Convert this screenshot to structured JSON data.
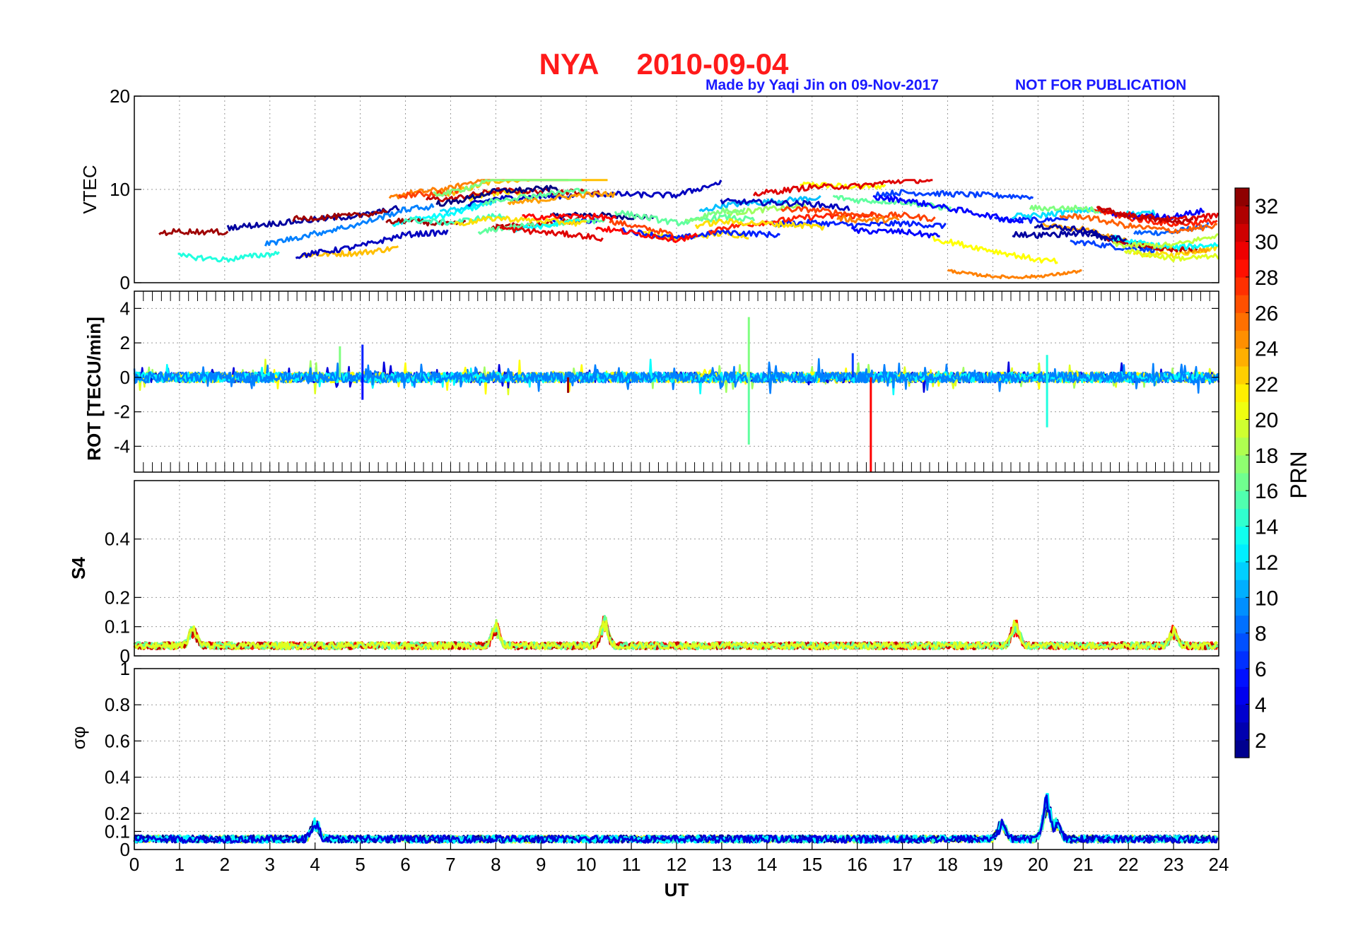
{
  "title": {
    "station": "NYA",
    "date": "2010-09-04",
    "color": "#ff1a1a"
  },
  "credit": {
    "made_by": "Made by Yaqi Jin on 09-Nov-2017",
    "notice": "NOT FOR PUBLICATION",
    "color": "#1a1aff"
  },
  "xaxis": {
    "label": "UT",
    "min": 0,
    "max": 24,
    "ticks": [
      0,
      1,
      2,
      3,
      4,
      5,
      6,
      7,
      8,
      9,
      10,
      11,
      12,
      13,
      14,
      15,
      16,
      17,
      18,
      19,
      20,
      21,
      22,
      23,
      24
    ]
  },
  "colorbar": {
    "label": "PRN",
    "min": 1,
    "max": 33,
    "ticks": [
      2,
      4,
      6,
      8,
      10,
      12,
      14,
      16,
      18,
      20,
      22,
      24,
      26,
      28,
      30,
      32
    ],
    "colormap": "jet"
  },
  "chart_data": [
    {
      "type": "line",
      "panel": "vtec",
      "ylabel": "VTEC",
      "ylim": [
        0,
        20
      ],
      "yticks": [
        0,
        10,
        20
      ],
      "series_summary": "Multi-PRN VTEC tracks, mostly 2-10 TECU; one low track near 0.5-1.5 TECU between 18-21 UT",
      "x": [
        0,
        1,
        2,
        3,
        4,
        5,
        6,
        7,
        8,
        9,
        10,
        11,
        12,
        13,
        14,
        15,
        16,
        17,
        18,
        19,
        20,
        21,
        22,
        23,
        24
      ],
      "typical_values": [
        5,
        5,
        4.5,
        5,
        5.5,
        6,
        7,
        7,
        8,
        8,
        8,
        7.5,
        7,
        8,
        8,
        8,
        7.5,
        7.5,
        7,
        6.5,
        6,
        6,
        5,
        4.5,
        5
      ]
    },
    {
      "type": "line",
      "panel": "rot",
      "ylabel": "ROT [TECU/min]",
      "ylim": [
        -5.5,
        5
      ],
      "yticks": [
        -4,
        -2,
        0,
        2,
        4
      ],
      "spikes": [
        {
          "x": 4.55,
          "y": 1.8,
          "prn": 17
        },
        {
          "x": 5.05,
          "y": 1.9,
          "prn": 6
        },
        {
          "x": 5.05,
          "y": -1.3,
          "prn": 5
        },
        {
          "x": 13.6,
          "y": 3.5,
          "prn": 17
        },
        {
          "x": 13.6,
          "y": -3.9,
          "prn": 16
        },
        {
          "x": 15.9,
          "y": 1.4,
          "prn": 7
        },
        {
          "x": 16.3,
          "y": -5.5,
          "prn": 29
        },
        {
          "x": 20.2,
          "y": 1.3,
          "prn": 14
        },
        {
          "x": 20.2,
          "y": -2.9,
          "prn": 14
        },
        {
          "x": 9.6,
          "y": -0.9,
          "prn": 32
        }
      ]
    },
    {
      "type": "line",
      "panel": "s4",
      "ylabel": "S4",
      "ylim": [
        0,
        0.6
      ],
      "yticks": [
        0,
        0.1,
        0.2,
        0.4
      ],
      "peaks": [
        {
          "x": 1.3,
          "y": 0.1
        },
        {
          "x": 8.0,
          "y": 0.11
        },
        {
          "x": 10.4,
          "y": 0.13
        },
        {
          "x": 19.5,
          "y": 0.12
        },
        {
          "x": 23.0,
          "y": 0.09
        }
      ],
      "baseline": 0.03
    },
    {
      "type": "line",
      "panel": "sigma_phi",
      "ylabel": "σφ",
      "ylim": [
        0,
        1
      ],
      "yticks": [
        0,
        0.1,
        0.2,
        0.4,
        0.6,
        0.8,
        1
      ],
      "peaks": [
        {
          "x": 4.0,
          "y": 0.17
        },
        {
          "x": 19.2,
          "y": 0.16
        },
        {
          "x": 20.2,
          "y": 0.31
        },
        {
          "x": 20.4,
          "y": 0.18
        }
      ],
      "baseline": 0.05
    }
  ]
}
